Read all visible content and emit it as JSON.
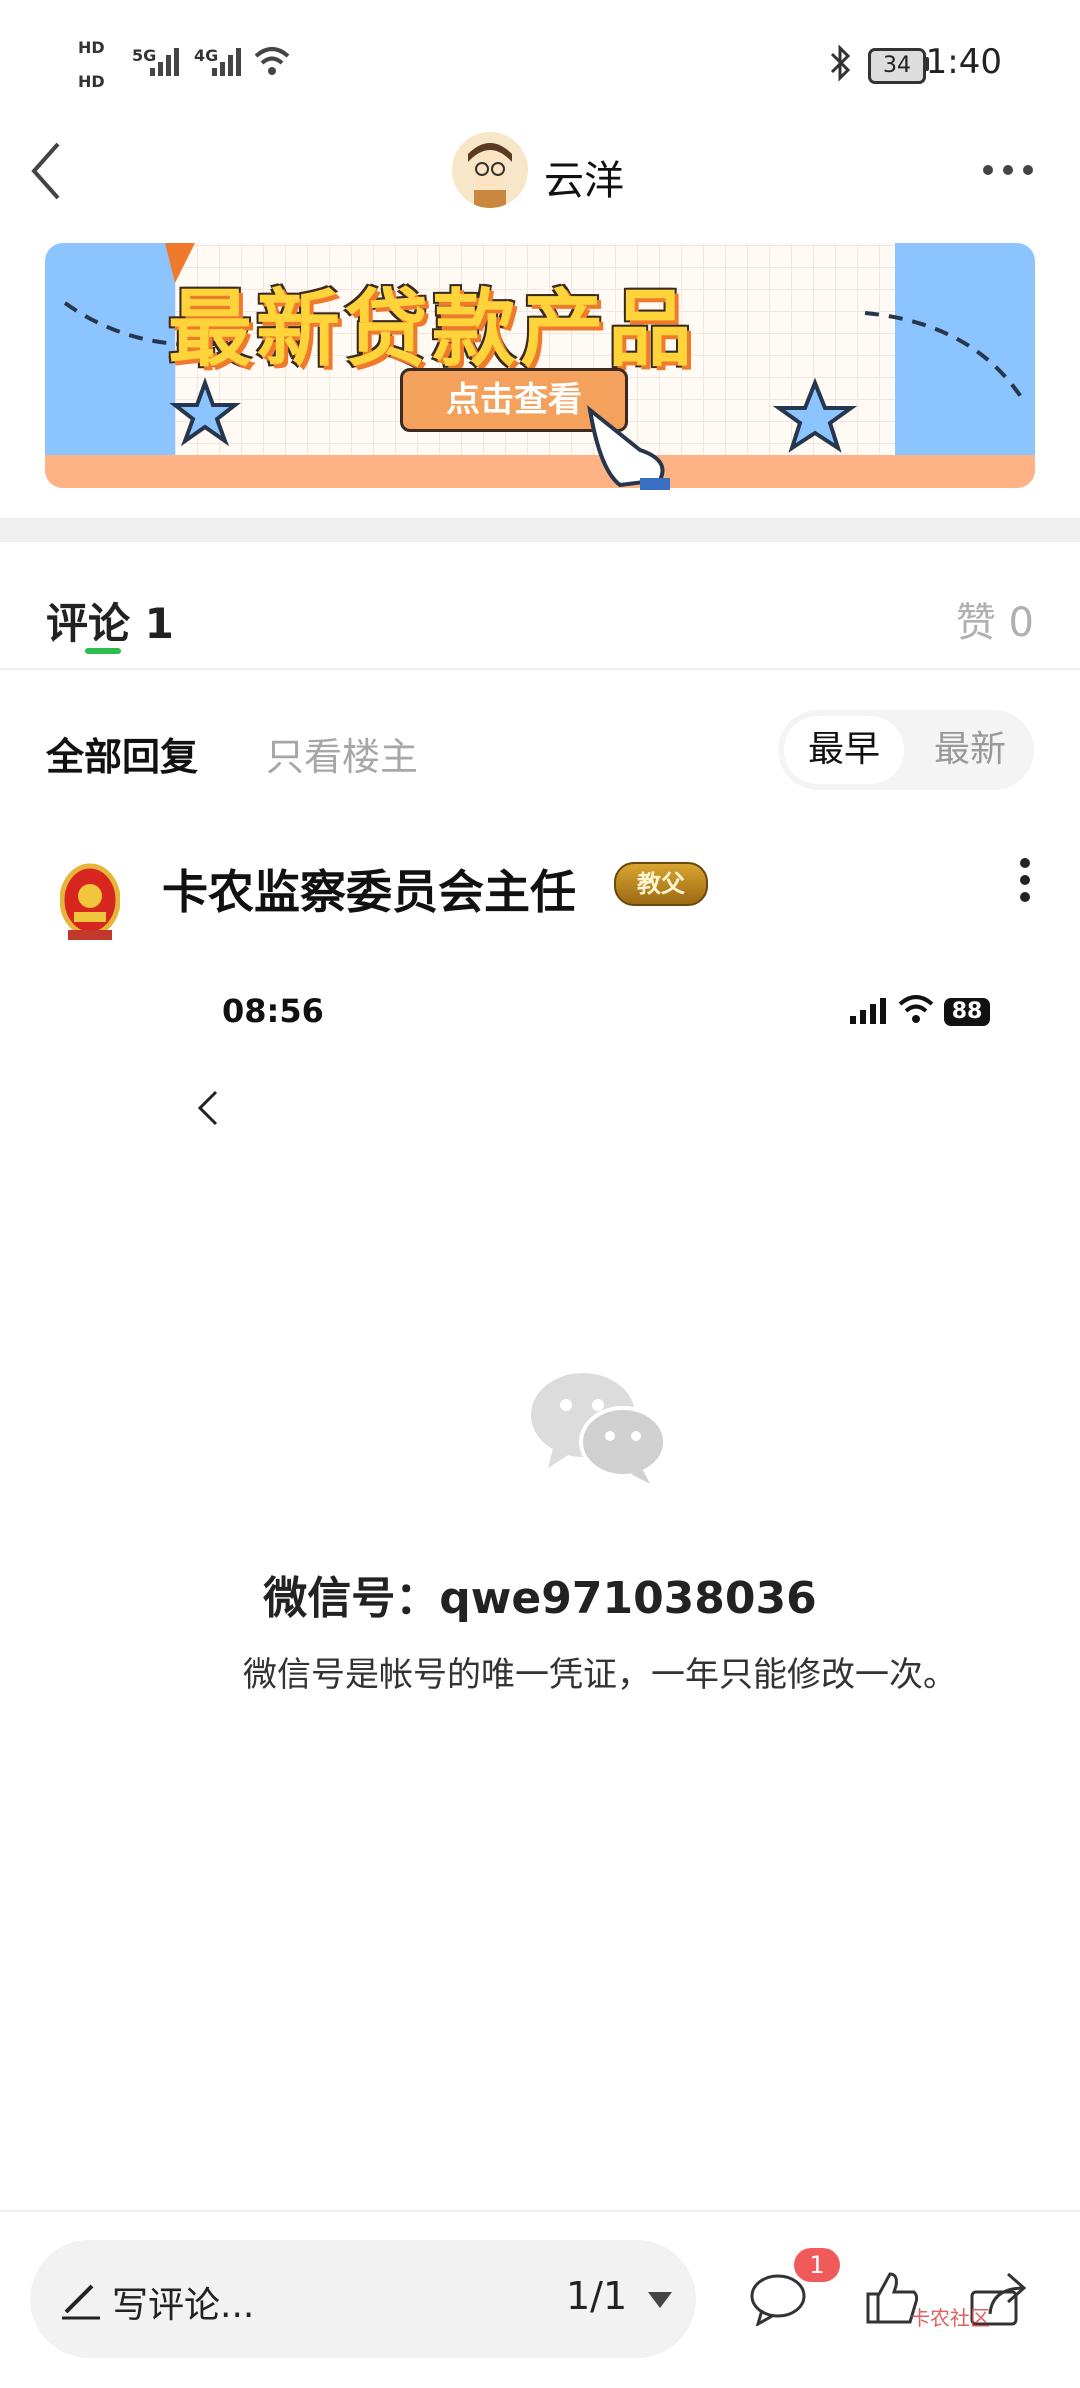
{
  "status_bar": {
    "hd1": "HD",
    "hd2": "HD",
    "net1": "5G",
    "net2": "4G",
    "battery": "34",
    "time": "1:40"
  },
  "header": {
    "title": "云洋",
    "back_icon": "chevron-left-icon",
    "more_icon": "more-dots-icon"
  },
  "banner": {
    "title": "最新贷款产品",
    "button": "点击查看"
  },
  "tabs": {
    "comment": "评论 1",
    "like": "赞 0",
    "accent": "#2ebd4d"
  },
  "filters": {
    "all": "全部回复",
    "owner_only": "只看楼主",
    "sort_early": "最早",
    "sort_new": "最新"
  },
  "comment": {
    "author": "卡农监察委员会主任",
    "badge": "教父",
    "embedded": {
      "time": "08:56",
      "battery": "88",
      "wechat_id": "微信号：qwe971038036",
      "description": "微信号是帐号的唯一凭证，一年只能修改一次。"
    }
  },
  "bottom_bar": {
    "write_placeholder": "写评论...",
    "pages": "1/1",
    "comment_count": "1",
    "watermark": "卡农社区"
  }
}
